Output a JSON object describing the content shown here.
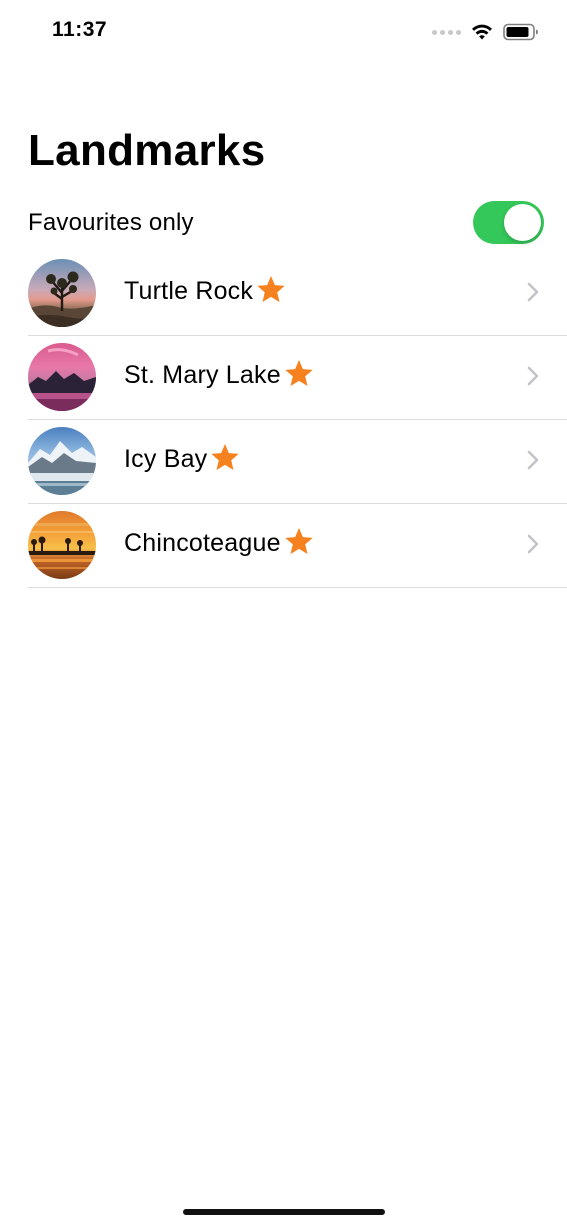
{
  "status_bar": {
    "time": "11:37",
    "icons": [
      "cellular-dots-icon",
      "wifi-icon",
      "battery-icon"
    ]
  },
  "title": "Landmarks",
  "filter": {
    "label": "Favourites only",
    "toggle_on": true,
    "toggle_color": "#34c759"
  },
  "colors": {
    "star": "#f5811f",
    "chevron": "#c4c4c8",
    "separator": "#dcdcdc"
  },
  "landmarks": [
    {
      "name": "Turtle Rock",
      "favorite": true,
      "icon": "star-icon"
    },
    {
      "name": "St. Mary Lake",
      "favorite": true,
      "icon": "star-icon"
    },
    {
      "name": "Icy Bay",
      "favorite": true,
      "icon": "star-icon"
    },
    {
      "name": "Chincoteague",
      "favorite": true,
      "icon": "star-icon"
    }
  ]
}
